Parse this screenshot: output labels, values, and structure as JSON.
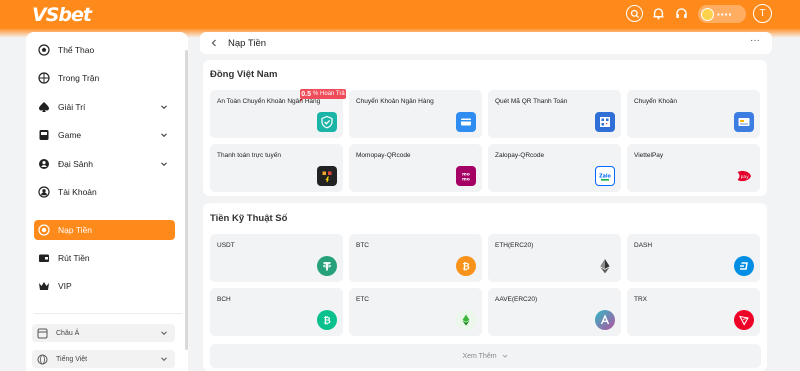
{
  "brand": {
    "logo": "VSbet",
    "accent": "#ff8a1c"
  },
  "topbar": {
    "icons": [
      "search-icon",
      "bell-icon",
      "headset-icon"
    ],
    "wallet_balance": "▪▪▪▪",
    "avatar_initial": "T"
  },
  "sidebar": {
    "items": [
      {
        "label": "Thể Thao",
        "icon": "soccer-ball-icon"
      },
      {
        "label": "Trong Trận",
        "icon": "live-ball-icon"
      },
      {
        "label": "Giải Trí",
        "icon": "spade-icon"
      },
      {
        "label": "Game",
        "icon": "game-machine-icon"
      },
      {
        "label": "Đại Sảnh",
        "icon": "lobby-icon"
      },
      {
        "label": "Tài Khoản",
        "icon": "user-icon"
      },
      {
        "label": "Nạp Tiền",
        "icon": "deposit-icon",
        "active": true
      },
      {
        "label": "Rút Tiền",
        "icon": "wallet-icon"
      },
      {
        "label": "VIP",
        "icon": "crown-icon"
      }
    ],
    "settings": [
      {
        "label": "Châu Á",
        "icon": "odds-format-icon"
      },
      {
        "label": "Tiếng Việt",
        "icon": "language-icon"
      }
    ]
  },
  "header": {
    "title": "Nạp Tiền",
    "more": "···"
  },
  "vnd_section": {
    "title": "Đồng Việt Nam",
    "badge": {
      "value": "0.5",
      "text": "% Hoàn Trả"
    },
    "cards": [
      {
        "label": "An Toàn Chuyển Khoản Ngân Hàng",
        "icon": "shield-check-icon",
        "color": "#1bb5a8"
      },
      {
        "label": "Chuyển Khoản Ngân Hàng",
        "icon": "bank-card-icon",
        "color": "#2f8cf0"
      },
      {
        "label": "Quét Mã QR Thanh Toán",
        "icon": "qr-scan-icon",
        "color": "#2f6fd6"
      },
      {
        "label": "Chuyển Khoản",
        "icon": "transfer-icon",
        "color": "#3b7de0"
      },
      {
        "label": "Thanh toán trực tuyến",
        "icon": "online-pay-icon",
        "color": "#222222"
      },
      {
        "label": "Momopay-QRcode",
        "icon": "momo-icon",
        "color": "#a50064"
      },
      {
        "label": "Zalopay-QRcode",
        "icon": "zalo-icon",
        "color": "#0068ff"
      },
      {
        "label": "ViettelPay",
        "icon": "viettelpay-icon",
        "color": "#e4002b"
      }
    ]
  },
  "crypto_section": {
    "title": "Tiền Kỹ Thuật Số",
    "cards": [
      {
        "label": "USDT",
        "icon": "usdt-icon",
        "color": "#26a17b"
      },
      {
        "label": "BTC",
        "icon": "btc-icon",
        "color": "#f7931a"
      },
      {
        "label": "ETH(ERC20)",
        "icon": "eth-icon",
        "color": "#343434"
      },
      {
        "label": "DASH",
        "icon": "dash-icon",
        "color": "#008de4"
      },
      {
        "label": "BCH",
        "icon": "bch-icon",
        "color": "#0ac18e"
      },
      {
        "label": "ETC",
        "icon": "etc-icon",
        "color": "#3ab83a"
      },
      {
        "label": "AAVE(ERC20)",
        "icon": "aave-icon",
        "color": "#7b5fc5"
      },
      {
        "label": "TRX",
        "icon": "trx-icon",
        "color": "#ef0027"
      }
    ],
    "see_more": "Xem Thêm"
  }
}
